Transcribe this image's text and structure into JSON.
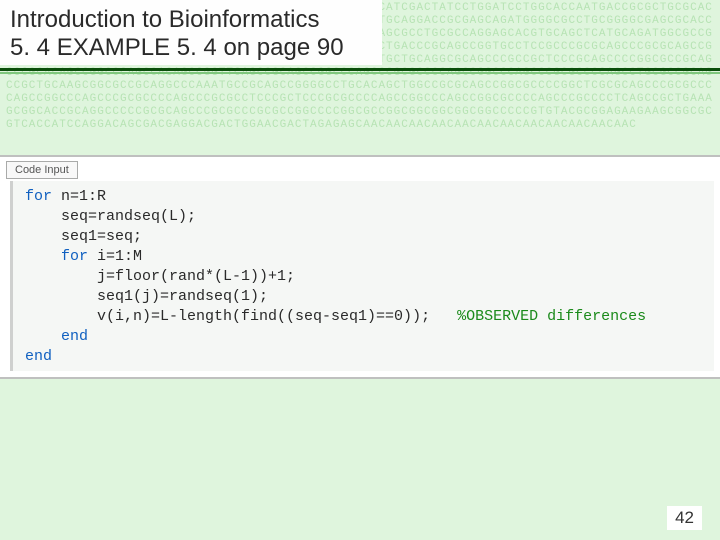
{
  "title": {
    "line1": "Introduction to Bioinformatics",
    "line2": "5. 4 EXAMPLE 5. 4 on page 90"
  },
  "code_tab_label": "Code Input",
  "code": {
    "l1a": "for",
    "l1b": " n=1:R",
    "l2": "    seq=randseq(L);",
    "l3": "    seq1=seq;",
    "l4a": "    for",
    "l4b": " i=1:M",
    "l5": "        j=floor(rand*(L-1))+1;",
    "l6": "        seq1(j)=randseq(1);",
    "l7a": "        v(i,n)=L-length(find((seq-seq1)==0));   ",
    "l7b": "%OBSERVED differences",
    "l8": "    end",
    "l9": "end"
  },
  "page_number": "42",
  "bg_dna": "AACAATTCAGCGCGTGATCAACAGCCTTAGCGGCTAAGTATGAGCAGACCATCGACTATCCTGGATCCTGGCACCAATGACCGCGCTGCGCACGAGGAGTATCACCGCGAGGAGTTCGCTGAGTTCTCCTCCGCCCTGGAGCTGCAGGACCGCGAGCAGATGGGGCGCCTGCGGGGCGAGCGCACCGAGGCGCAGAAGATGATCGAGCGCGCCATGGCCCTGCGCAAGGAGATCGAGCGCCTGCGCCAGGAGCACGTGCAGCTCATGCAGATGGCGCCGTCCACCCAGACAGCGTGTGTCGTGGCTCGCCCCGACCAGACGCAGCCCGCTGACCCGCAGCCGGTGCCTCCGCCCGCGCAGCCCGCGCAGCCGGCGCAGCCGCAGCCGCAGCCGGCACCGCAGCCGGCGGCGCAGCTGTCGCTGCTGCAGGCGCAGCCCGCCGCTCCCGCAGCCCCGGCGCCGCAGCCCGCACAGCCGGCCCAGCCACAGCCGGTTCAGCCGCAGCCGGCCCAGCCCGCGCCCCAGCCGGCCCAGCCCGCGCCCCAGCCTGCGCCGCAGCCGCTGCAAGCGGCGCCGCAGGCCCAAATGCCGCAGCCGGGGCCTGCACAGCTGGCCGCGCAGCCGGCGCCCCGGCTCGCGCAGCCCGCGCCCCAGCCGGCCCAGCCCGCGCCCCAGCCCGCGCCTCCCGCTCCCGCGCCCCAGCCGGCCCAGCCGGCGCCCCAGCCCGCCCCTCAGCCGCTGAAAGCGGCACCGCAGGCCCCCGCGCAGCCCGCGCCCGCGCCGGCCCCGGCGCCGGCGGCGGCGGCGGCCCCCGTGTACGCGGAGAAGAAGCGGCGCGTCACCATCCAGGACAGCGACGAGGACGACTGGAACGACTAGAGAGCAACAACAACAACAACAACAACAACAACAACAACAAC"
}
